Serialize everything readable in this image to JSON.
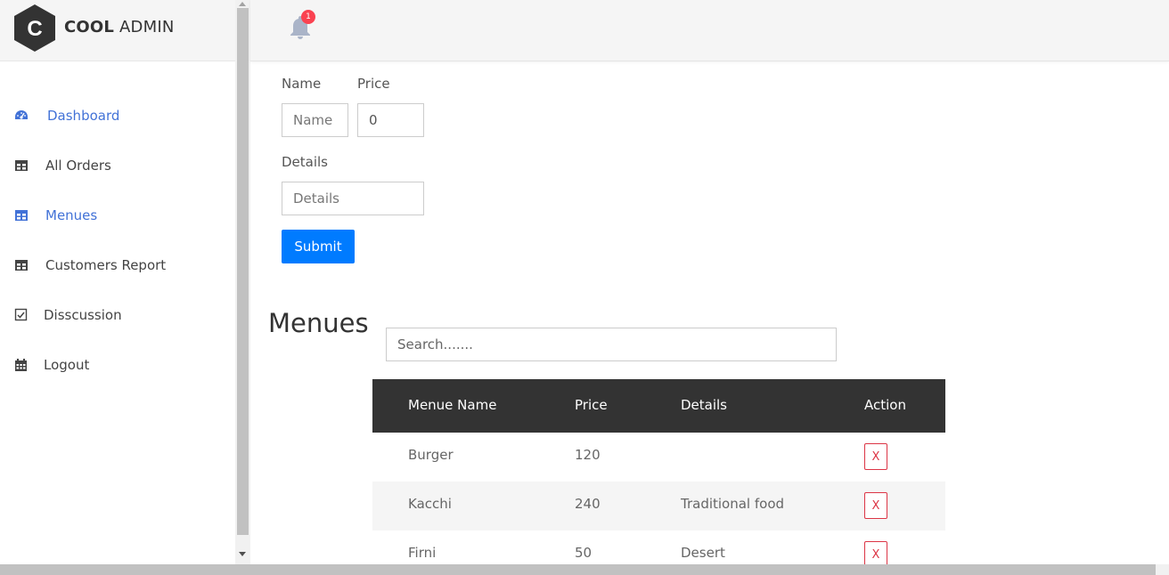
{
  "brand": {
    "bold": "COOL",
    "light": "ADMIN",
    "letter": "C"
  },
  "notifications": {
    "count": "1"
  },
  "sidebar": {
    "items": [
      {
        "label": "Dashboard",
        "icon": "dashboard-gauge-icon"
      },
      {
        "label": "All Orders",
        "icon": "table-icon"
      },
      {
        "label": "Menues",
        "icon": "table-icon"
      },
      {
        "label": "Customers Report",
        "icon": "table-icon"
      },
      {
        "label": "Disscussion",
        "icon": "checkbox-icon"
      },
      {
        "label": "Logout",
        "icon": "calendar-icon"
      }
    ]
  },
  "form": {
    "name_label": "Name",
    "name_placeholder": "Name",
    "price_label": "Price",
    "price_value": "0",
    "details_label": "Details",
    "details_placeholder": "Details",
    "submit_label": "Submit"
  },
  "menues": {
    "title": "Menues",
    "search_placeholder": "Search.......",
    "columns": [
      "Menue Name",
      "Price",
      "Details",
      "Action"
    ],
    "rows": [
      {
        "name": "Burger",
        "price": "120",
        "details": "",
        "action": "X"
      },
      {
        "name": "Kacchi",
        "price": "240",
        "details": "Traditional food",
        "action": "X"
      },
      {
        "name": "Firni",
        "price": "50",
        "details": "Desert",
        "action": "X"
      }
    ]
  },
  "colors": {
    "accent": "#4272d7",
    "primary_button": "#007bff",
    "danger": "#dc3545",
    "table_header": "#333333",
    "badge": "#fa4251"
  }
}
